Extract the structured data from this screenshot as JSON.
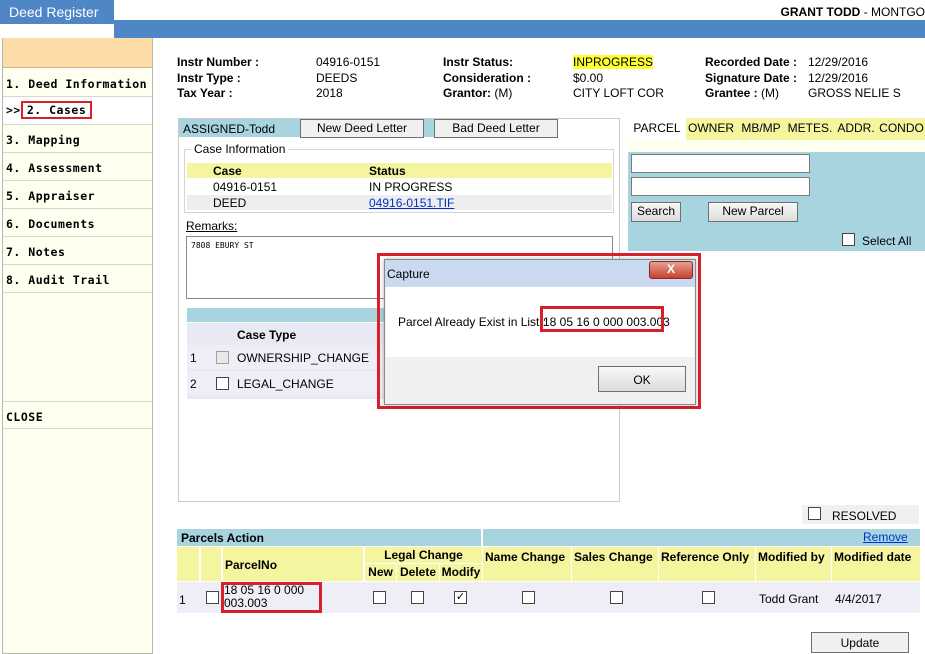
{
  "app": {
    "title": "Deed Register"
  },
  "user": {
    "name": "GRANT TODD",
    "suffix": " - MONTGO"
  },
  "sidebar": {
    "items": [
      {
        "label": "1. Deed Information"
      },
      {
        "prefix": ">>",
        "label": "2. Cases"
      },
      {
        "label": "3. Mapping"
      },
      {
        "label": "4. Assessment"
      },
      {
        "label": "5. Appraiser"
      },
      {
        "label": "6. Documents"
      },
      {
        "label": "7. Notes"
      },
      {
        "label": "8. Audit Trail"
      }
    ],
    "close_label": "CLOSE"
  },
  "header": {
    "instr_number_label": "Instr Number :",
    "instr_number": "04916-0151",
    "instr_type_label": "Instr Type :",
    "instr_type": "DEEDS",
    "tax_year_label": "Tax Year :",
    "tax_year": "2018",
    "instr_status_label": "Instr Status:",
    "instr_status": "INPROGRESS",
    "consideration_label": "Consideration :",
    "consideration": "$0.00",
    "grantor_label": "Grantor:",
    "grantor_suffix": "(M)",
    "grantor": "CITY LOFT COR",
    "recorded_date_label": "Recorded Date :",
    "recorded_date": "12/29/2016",
    "signature_date_label": "Signature Date :",
    "signature_date": "12/29/2016",
    "grantee_label": "Grantee :",
    "grantee_suffix": "(M)",
    "grantee": "GROSS NELIE S"
  },
  "case_panel": {
    "assigned": "ASSIGNED-Todd",
    "new_deed_letter": "New Deed Letter",
    "bad_deed_letter": "Bad Deed Letter",
    "legend": "Case Information",
    "columns": [
      "Case",
      "Status"
    ],
    "rows": [
      {
        "case": "04916-0151",
        "status": "IN PROGRESS"
      },
      {
        "case": "DEED",
        "status": " 04916-0151.TIF"
      }
    ],
    "remarks_label": "Remarks:",
    "remarks": "7808 EBURY ST",
    "case_type_header": "Case Type",
    "case_types": [
      {
        "num": "1",
        "label": "OWNERSHIP_CHANGE"
      },
      {
        "num": "2",
        "label": "LEGAL_CHANGE"
      }
    ]
  },
  "right_panel": {
    "tabs": [
      "PARCEL",
      "OWNER",
      "MB/MP",
      "METES.",
      "ADDR.",
      "CONDO"
    ],
    "search_button": "Search",
    "new_parcel_button": "New Parcel",
    "select_all_label": "Select All"
  },
  "resolved_label": "RESOLVED",
  "dialog": {
    "title": "Capture",
    "close_glyph": "X",
    "message_prefix": "Parcel Already Exist in List :",
    "parcel": "18 05 16 0 000 003.003",
    "ok_label": "OK"
  },
  "parcels_action": {
    "title": "Parcels Action",
    "remove_label": "Remove",
    "headers": {
      "parcel_no": "ParcelNo",
      "legal_change": "Legal Change",
      "new": "New",
      "delete": "Delete",
      "modify": "Modify",
      "name_change": "Name Change",
      "sales_change": "Sales Change",
      "reference_only": "Reference Only",
      "modified_by": "Modified by",
      "modified_date": "Modified date"
    },
    "rows": [
      {
        "num": "1",
        "parcel_line1": "18 05 16 0 000",
        "parcel_line2": "003.003",
        "modify_checked": true,
        "modified_by": "Todd Grant",
        "modified_date": "4/4/2017"
      }
    ]
  },
  "update_button": "Update",
  "colors": {
    "accent": "#4f86c6",
    "highlight": "#ffff33",
    "callout": "#d8202a",
    "panel_blue": "#a8d4e0",
    "header_yellow": "#f5f5a0"
  }
}
